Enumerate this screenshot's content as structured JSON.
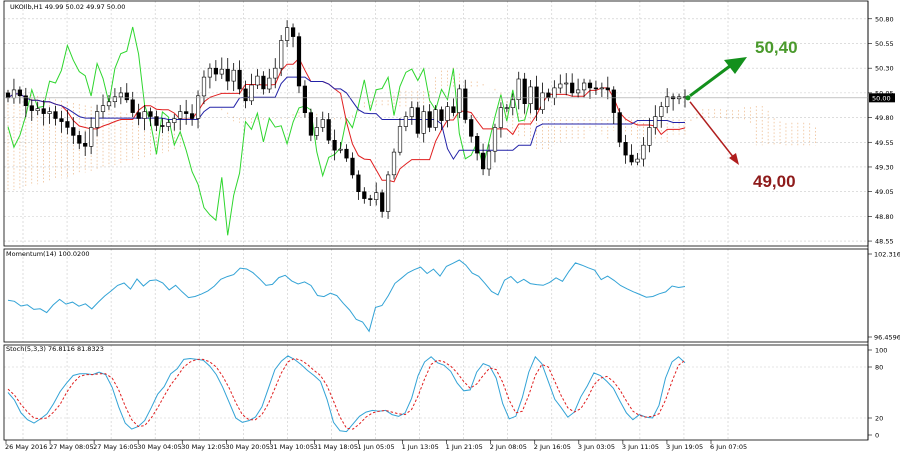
{
  "colors": {
    "background": "#ffffff",
    "grid": "#c9c9c9",
    "bull_candle": "#ffffff",
    "bear_candle": "#000000",
    "tenkan": "#e01f1f",
    "kijun": "#2323a8",
    "chikou": "#2ed62e",
    "cloud": "#e8a66a",
    "momentum": "#33a3d6",
    "stoch_main": "#33a3d6",
    "stoch_signal": "#e01f1f",
    "arrow_up": "#13901c",
    "arrow_down": "#b01e1e",
    "label_up": "#4a9a2c",
    "label_down": "#8e1b1b"
  },
  "main_header": "UKOIlb,H1  49.99 50.02 49.97 50.00",
  "current_price_tag": "50.00",
  "momentum_header": "Momentum(14) 100.0200",
  "stoch_header": "Stoch(5,3,3) 76.8116 81.8323",
  "annotations": {
    "up_target": "50,40",
    "down_target": "49,00"
  },
  "chart_data": [
    {
      "type": "candlestick",
      "symbol": "UKOIlb",
      "timeframe": "H1",
      "ohlc_header": [
        49.99,
        50.02,
        49.97,
        50.0
      ],
      "ylim": [
        48.5,
        50.98
      ],
      "y_ticks": [
        "50.80",
        "50.55",
        "50.30",
        "50.05",
        "49.80",
        "49.55",
        "49.30",
        "49.05",
        "48.80",
        "48.55"
      ],
      "grid": true,
      "close_series": [
        50.0,
        50.08,
        50.02,
        49.92,
        49.87,
        49.89,
        49.84,
        49.86,
        49.79,
        49.76,
        49.7,
        49.62,
        49.54,
        49.51,
        49.7,
        49.86,
        49.92,
        49.96,
        50.01,
        50.05,
        49.98,
        49.85,
        49.79,
        49.86,
        49.81,
        49.72,
        49.71,
        49.75,
        49.79,
        49.86,
        49.84,
        49.79,
        50.02,
        50.21,
        50.3,
        50.24,
        50.29,
        50.17,
        50.28,
        50.09,
        49.97,
        50.13,
        50.22,
        50.09,
        50.2,
        50.3,
        50.58,
        50.71,
        50.62,
        50.12,
        49.85,
        49.62,
        49.7,
        49.78,
        49.57,
        49.47,
        49.48,
        49.39,
        49.22,
        49.05,
        48.98,
        48.97,
        49.04,
        48.85,
        49.22,
        49.45,
        49.71,
        49.81,
        49.9,
        49.64,
        49.86,
        49.7,
        49.88,
        49.77,
        49.91,
        49.85,
        50.09,
        49.78,
        49.61,
        49.44,
        49.28,
        49.46,
        49.7,
        49.9,
        49.9,
        49.98,
        50.19,
        49.94,
        50.11,
        49.88,
        50.05,
        50.0,
        50.1,
        50.14,
        50.15,
        50.05,
        50.08,
        50.15,
        50.1,
        50.09,
        50.1,
        50.08,
        49.85,
        49.55,
        49.42,
        49.35,
        49.38,
        49.52,
        49.7,
        49.81,
        49.91,
        50.01,
        49.99,
        50.01,
        50.0
      ],
      "projection": {
        "up_target": 50.4,
        "down_target": 49.0
      },
      "x_tick_labels": [
        "26 May 2016",
        "27 May 08:05",
        "27 May 16:05",
        "30 May 04:05",
        "30 May 12:05",
        "30 May 20:05",
        "31 May 10:05",
        "31 May 18:05",
        "1 Jun 05:05",
        "1 Jun 13:05",
        "1 Jun 21:05",
        "2 Jun 08:05",
        "2 Jun 16:05",
        "3 Jun 03:05",
        "3 Jun 11:05",
        "3 Jun 19:05",
        "6 Jun 07:05"
      ]
    },
    {
      "type": "line",
      "name": "Momentum(14)",
      "header_value": 100.02,
      "ylim": [
        96.4596,
        102.3162
      ],
      "y_ticks": [
        "102.3162",
        "96.4596"
      ],
      "values": [
        99.05,
        98.98,
        98.65,
        98.73,
        98.41,
        98.45,
        98.18,
        98.72,
        99.11,
        98.78,
        98.92,
        98.63,
        98.8,
        98.44,
        98.92,
        99.35,
        99.71,
        100.1,
        100.27,
        99.84,
        100.55,
        100.06,
        100.44,
        100.49,
        100.28,
        99.78,
        100.11,
        99.65,
        99.24,
        99.32,
        99.49,
        99.71,
        100.05,
        100.53,
        100.72,
        100.86,
        101.32,
        101.26,
        101.0,
        100.57,
        100.1,
        100.17,
        100.65,
        100.81,
        100.42,
        100.2,
        100.35,
        100.09,
        99.39,
        99.31,
        99.55,
        99.38,
        98.84,
        98.36,
        97.7,
        97.52,
        96.86,
        98.55,
        98.68,
        99.39,
        100.24,
        100.6,
        100.98,
        101.21,
        101.39,
        100.94,
        101.25,
        100.76,
        101.44,
        101.66,
        101.89,
        101.53,
        100.97,
        100.74,
        100.23,
        99.67,
        99.43,
        100.47,
        100.73,
        100.28,
        100.53,
        100.23,
        100.16,
        100.11,
        100.31,
        100.64,
        100.39,
        101.09,
        101.69,
        101.53,
        101.34,
        101.17,
        100.51,
        100.76,
        100.45,
        100.09,
        99.86,
        99.65,
        99.46,
        99.27,
        99.32,
        99.51,
        99.64,
        100.06,
        99.95,
        100.02
      ]
    },
    {
      "type": "line",
      "name": "Stoch(5,3,3)",
      "header_values": [
        76.8116,
        81.8323
      ],
      "ylim": [
        0,
        100
      ],
      "y_ticks": [
        "100",
        "80",
        "20",
        "0"
      ],
      "main": [
        50,
        41,
        26,
        18,
        14,
        19,
        25,
        37,
        51,
        61,
        70,
        72,
        72,
        71,
        74,
        71,
        56,
        33,
        14,
        7,
        10,
        17,
        32,
        48,
        57,
        72,
        78,
        89,
        90,
        89,
        88,
        81,
        71,
        56,
        38,
        20,
        15,
        17,
        21,
        33,
        55,
        77,
        87,
        93,
        89,
        83,
        76,
        70,
        63,
        42,
        15,
        5,
        4,
        13,
        22,
        27,
        29,
        28,
        29,
        24,
        22,
        26,
        43,
        70,
        86,
        92,
        85,
        82,
        75,
        61,
        52,
        53,
        74,
        84,
        81,
        67,
        37,
        19,
        22,
        44,
        74,
        92,
        84,
        63,
        42,
        32,
        21,
        27,
        45,
        58,
        73,
        70,
        63,
        55,
        40,
        26,
        18,
        24,
        21,
        20,
        35,
        67,
        86,
        92,
        85
      ],
      "signal": [
        54,
        47,
        36,
        27,
        20,
        19,
        20,
        27,
        36,
        50,
        61,
        69,
        71,
        71,
        72,
        72,
        67,
        53,
        34,
        18,
        10,
        11,
        20,
        32,
        46,
        59,
        69,
        80,
        86,
        89,
        89,
        86,
        80,
        69,
        55,
        38,
        24,
        18,
        18,
        24,
        37,
        55,
        73,
        86,
        90,
        88,
        83,
        76,
        70,
        58,
        40,
        21,
        8,
        7,
        13,
        21,
        26,
        28,
        29,
        27,
        25,
        24,
        30,
        46,
        66,
        83,
        88,
        86,
        81,
        73,
        63,
        55,
        60,
        70,
        79,
        77,
        62,
        41,
        26,
        28,
        47,
        70,
        83,
        80,
        63,
        46,
        32,
        27,
        31,
        43,
        59,
        67,
        69,
        63,
        53,
        40,
        28,
        23,
        21,
        22,
        25,
        41,
        63,
        82,
        88
      ]
    }
  ]
}
